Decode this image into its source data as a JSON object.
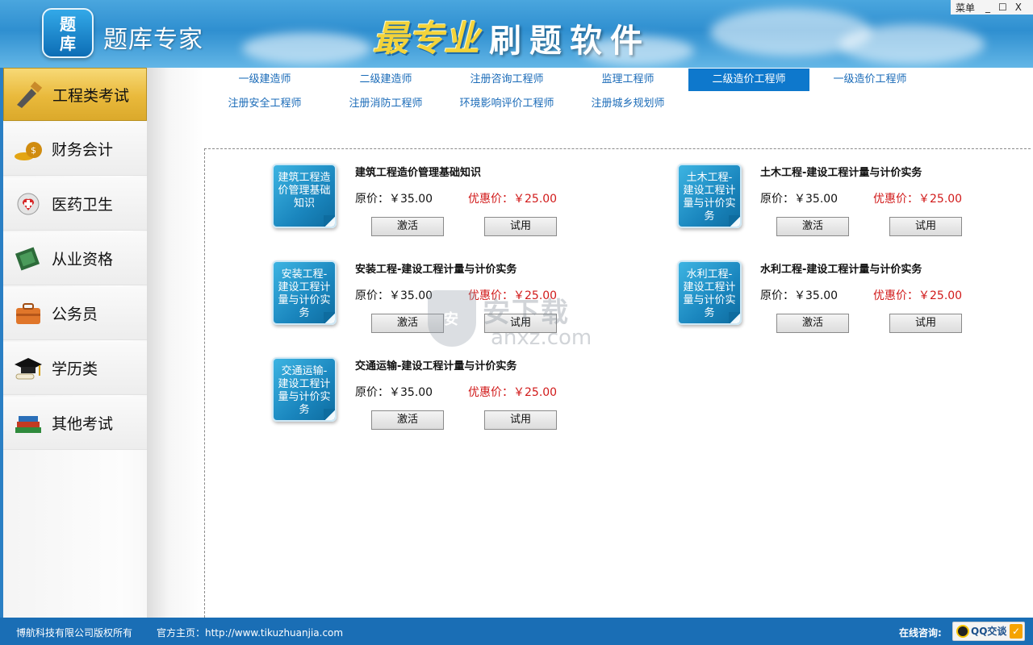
{
  "header": {
    "logo_line1": "题",
    "logo_line2": "库",
    "app_name": "题库专家",
    "brand_mark": "最专业",
    "banner_title": "刷题软件"
  },
  "window": {
    "menu": "菜单",
    "minimize": "_",
    "maximize": "☐",
    "close": "X"
  },
  "sidebar": {
    "items": [
      {
        "label": "工程类考试",
        "icon": "trowel-icon",
        "active": true
      },
      {
        "label": "财务会计",
        "icon": "money-bag-icon"
      },
      {
        "label": "医药卫生",
        "icon": "medical-icon"
      },
      {
        "label": "从业资格",
        "icon": "certificate-icon"
      },
      {
        "label": "公务员",
        "icon": "briefcase-icon"
      },
      {
        "label": "学历类",
        "icon": "graduation-cap-icon"
      },
      {
        "label": "其他考试",
        "icon": "books-icon"
      }
    ]
  },
  "tabs": [
    {
      "label": "一级建造师"
    },
    {
      "label": "二级建造师"
    },
    {
      "label": "注册咨询工程师"
    },
    {
      "label": "监理工程师"
    },
    {
      "label": "二级造价工程师",
      "active": true
    },
    {
      "label": "一级造价工程师"
    },
    {
      "label": "注册安全工程师"
    },
    {
      "label": "注册消防工程师"
    },
    {
      "label": "环境影响评价工程师"
    },
    {
      "label": "注册城乡规划师"
    }
  ],
  "courses": [
    {
      "cover": "建筑工程造价管理基础知识",
      "title": "建筑工程造价管理基础知识",
      "original": "原价：￥35.00",
      "discount": "优惠价：￥25.00",
      "activate": "激活",
      "trial": "试用"
    },
    {
      "cover": "土木工程-建设工程计量与计价实务",
      "title": "土木工程-建设工程计量与计价实务",
      "original": "原价：￥35.00",
      "discount": "优惠价：￥25.00",
      "activate": "激活",
      "trial": "试用"
    },
    {
      "cover": "安装工程-建设工程计量与计价实务",
      "title": "安装工程-建设工程计量与计价实务",
      "original": "原价：￥35.00",
      "discount": "优惠价：￥25.00",
      "activate": "激活",
      "trial": "试用"
    },
    {
      "cover": "水利工程-建设工程计量与计价实务",
      "title": "水利工程-建设工程计量与计价实务",
      "original": "原价：￥35.00",
      "discount": "优惠价：￥25.00",
      "activate": "激活",
      "trial": "试用"
    },
    {
      "cover": "交通运输-建设工程计量与计价实务",
      "title": "交通运输-建设工程计量与计价实务",
      "original": "原价：￥35.00",
      "discount": "优惠价：￥25.00",
      "activate": "激活",
      "trial": "试用"
    }
  ],
  "watermark": {
    "cn": "安下载",
    "en": "anxz.com",
    "shield": "安"
  },
  "footer": {
    "copyright": "博航科技有限公司版权所有",
    "homepage": "官方主页：http://www.tikuzhuanjia.com",
    "online_label": "在线咨询:",
    "qq_label": "QQ交谈"
  },
  "colors": {
    "accent": "#0e78cc",
    "header": "#2f8fd0",
    "footer": "#1a6eb5",
    "discount": "#d11a1a",
    "active_side": "#e9b93b"
  }
}
